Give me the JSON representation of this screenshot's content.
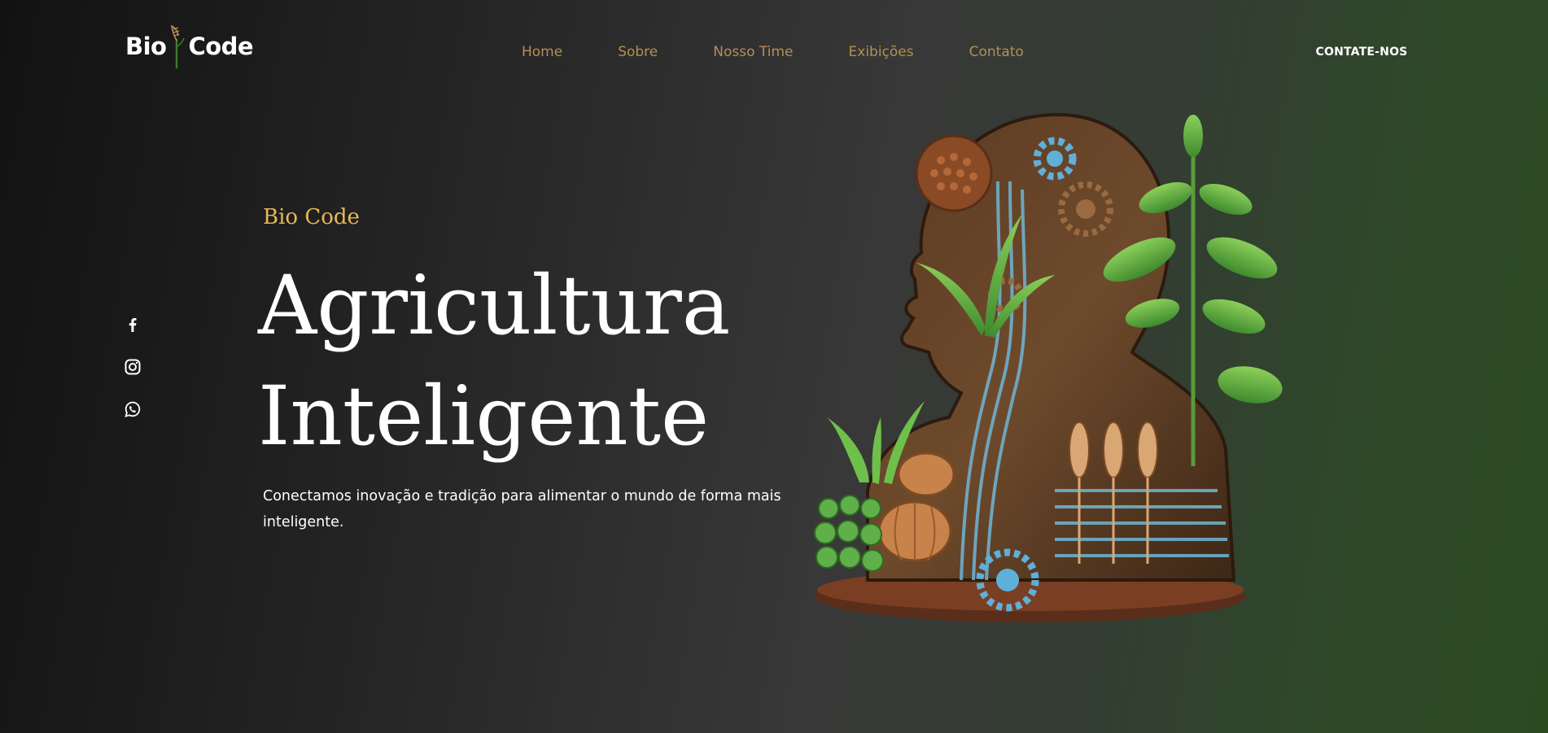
{
  "brand": {
    "name_part1": "Bio",
    "name_part2": "Code"
  },
  "nav": {
    "items": [
      "Home",
      "Sobre",
      "Nosso Time",
      "Exibições",
      "Contato"
    ]
  },
  "cta_label": "CONTATE-NOS",
  "social_icons": [
    "facebook-icon",
    "instagram-icon",
    "whatsapp-icon"
  ],
  "hero": {
    "eyebrow": "Bio Code",
    "headline_line1": "Agricultura",
    "headline_line2": "Inteligente",
    "subtitle": "Conectamos inovação e tradição para alimentar o mundo de forma mais inteligente."
  },
  "colors": {
    "accent_gold": "#e8b857",
    "nav_link": "#b48f52",
    "text": "#ffffff",
    "background_dark": "#121212",
    "background_green": "#2b4a22"
  }
}
